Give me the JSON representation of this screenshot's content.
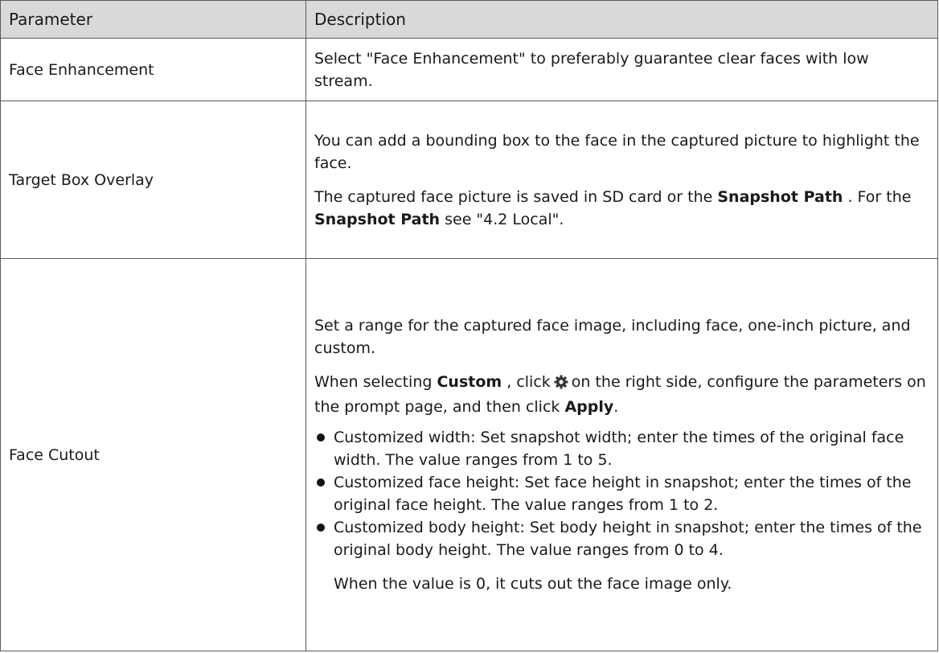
{
  "table": {
    "headers": {
      "parameter": "Parameter",
      "description": "Description"
    },
    "rows": [
      {
        "name": "Face Enhancement",
        "desc": "Select \"Face Enhancement\" to preferably guarantee clear faces with low stream."
      },
      {
        "name": "Target Box Overlay",
        "p1": "You can add a bounding box to the face in the captured picture to highlight the face.",
        "p2": {
          "t1": "The captured face picture is saved in SD card or the ",
          "b1": "Snapshot Path",
          "t2": " . For the ",
          "b2": "Snapshot Path",
          "t3": " see \"4.2 Local\"."
        }
      },
      {
        "name": "Face Cutout",
        "p1": "Set a range for the captured face image, including face, one-inch picture, and custom.",
        "p2": {
          "t1": "When selecting ",
          "b1": "Custom",
          "t2": " , click",
          "icon": "gear-icon",
          "t3": "on the right side, configure the parameters on the prompt page, and then click ",
          "b2": "Apply",
          "t4": "."
        },
        "bullets": [
          "Customized width: Set snapshot width; enter the times of the original face width. The value ranges from 1 to 5.",
          "Customized face height: Set face height in snapshot; enter the times of the original face height. The value ranges from 1 to 2.",
          "Customized body height: Set body height in snapshot; enter the times of the original body height. The value ranges from 0 to 4."
        ],
        "note": "When the value is 0, it cuts out the face image only."
      }
    ]
  }
}
